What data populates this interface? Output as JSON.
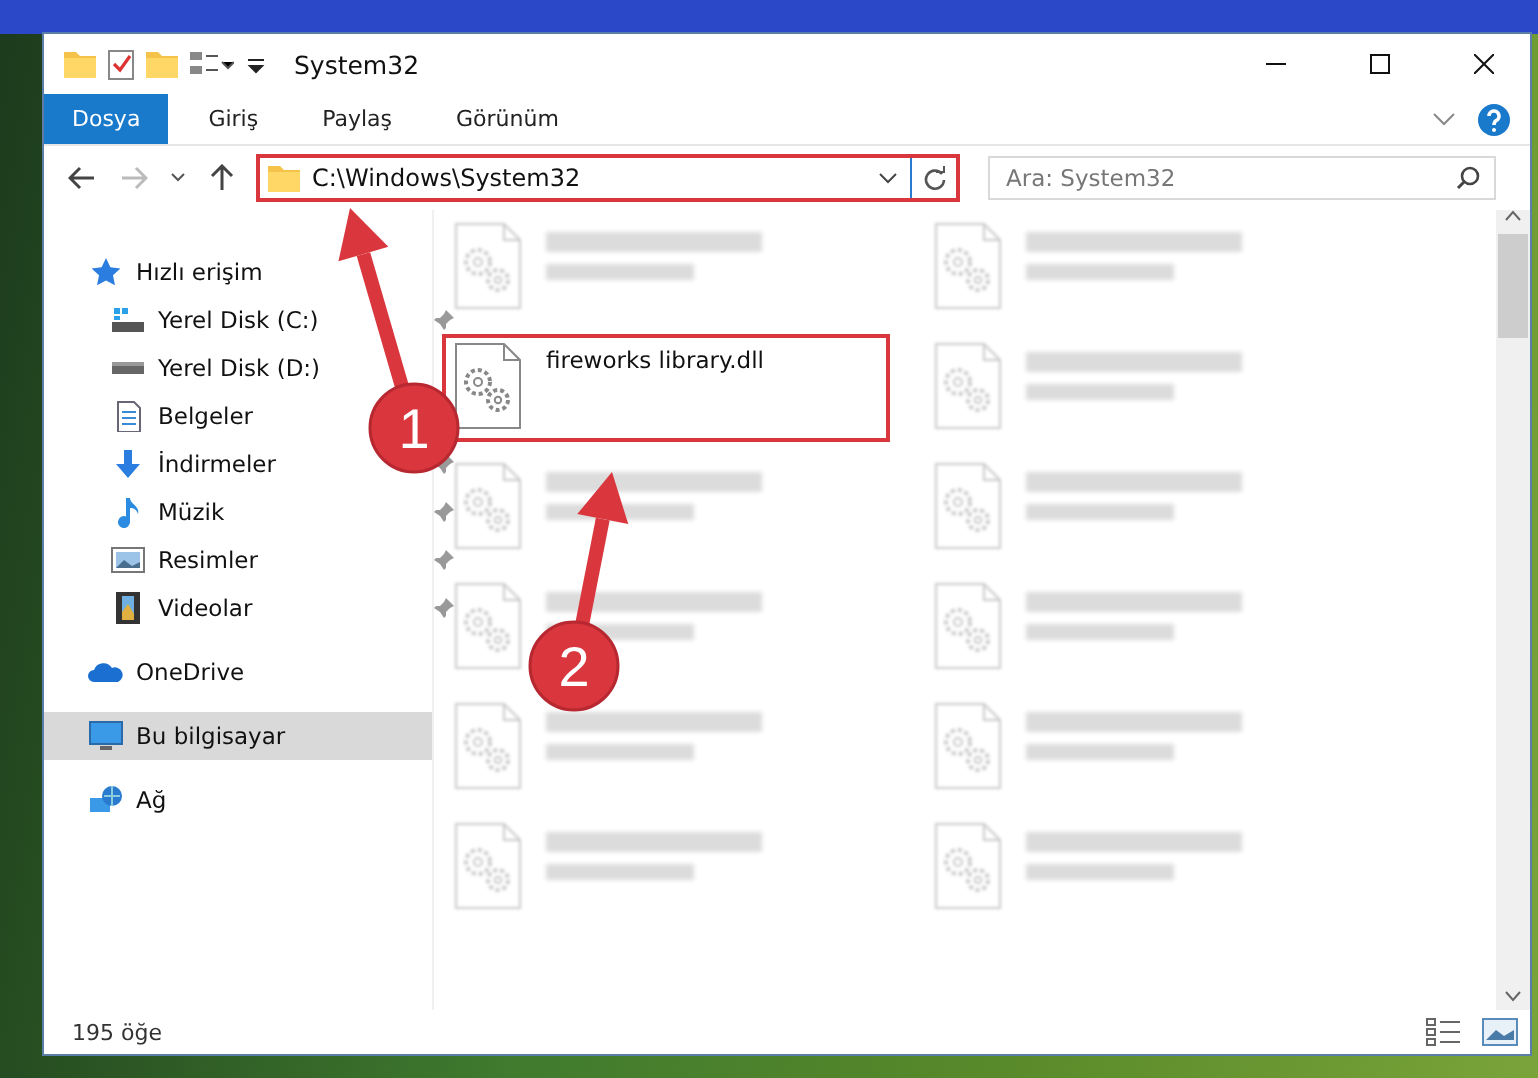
{
  "window": {
    "title": "System32"
  },
  "ribbon_tabs": [
    {
      "label": "Dosya",
      "selected": true
    },
    {
      "label": "Giriş",
      "selected": false
    },
    {
      "label": "Paylaş",
      "selected": false
    },
    {
      "label": "Görünüm",
      "selected": false
    }
  ],
  "address": {
    "path": "C:\\Windows\\System32",
    "highlighted": true
  },
  "search": {
    "placeholder": "Ara: System32"
  },
  "sidebar": {
    "items": [
      {
        "label": "Hızlı erişim",
        "kind": "star",
        "selected": false,
        "children": [
          {
            "label": "Yerel Disk (C:)",
            "kind": "windrive",
            "pinned": true
          },
          {
            "label": "Yerel Disk (D:)",
            "kind": "drive",
            "pinned": false
          },
          {
            "label": "Belgeler",
            "kind": "document",
            "pinned": false
          },
          {
            "label": "İndirmeler",
            "kind": "download",
            "pinned": true
          },
          {
            "label": "Müzik",
            "kind": "music",
            "pinned": true
          },
          {
            "label": "Resimler",
            "kind": "pictures",
            "pinned": true
          },
          {
            "label": "Videolar",
            "kind": "video",
            "pinned": true
          }
        ]
      },
      {
        "label": "OneDrive",
        "kind": "cloud",
        "selected": false
      },
      {
        "label": "Bu bilgisayar",
        "kind": "computer",
        "selected": true
      },
      {
        "label": "Ağ",
        "kind": "network",
        "selected": false
      }
    ]
  },
  "files": [
    {
      "kind": "blurred",
      "highlighted": false
    },
    {
      "kind": "blurred",
      "highlighted": false
    },
    {
      "kind": "file",
      "name": "fireworks library.dll",
      "highlighted": true
    },
    {
      "kind": "blurred",
      "highlighted": false
    },
    {
      "kind": "blurred",
      "highlighted": false
    },
    {
      "kind": "blurred",
      "highlighted": false
    },
    {
      "kind": "blurred",
      "highlighted": false
    },
    {
      "kind": "blurred",
      "highlighted": false
    },
    {
      "kind": "blurred",
      "highlighted": false
    },
    {
      "kind": "blurred",
      "highlighted": false
    },
    {
      "kind": "blurred",
      "highlighted": false
    },
    {
      "kind": "blurred",
      "highlighted": false
    }
  ],
  "callouts": [
    {
      "number": "1"
    },
    {
      "number": "2"
    }
  ],
  "status_bar": {
    "item_count": "195 öğe"
  }
}
